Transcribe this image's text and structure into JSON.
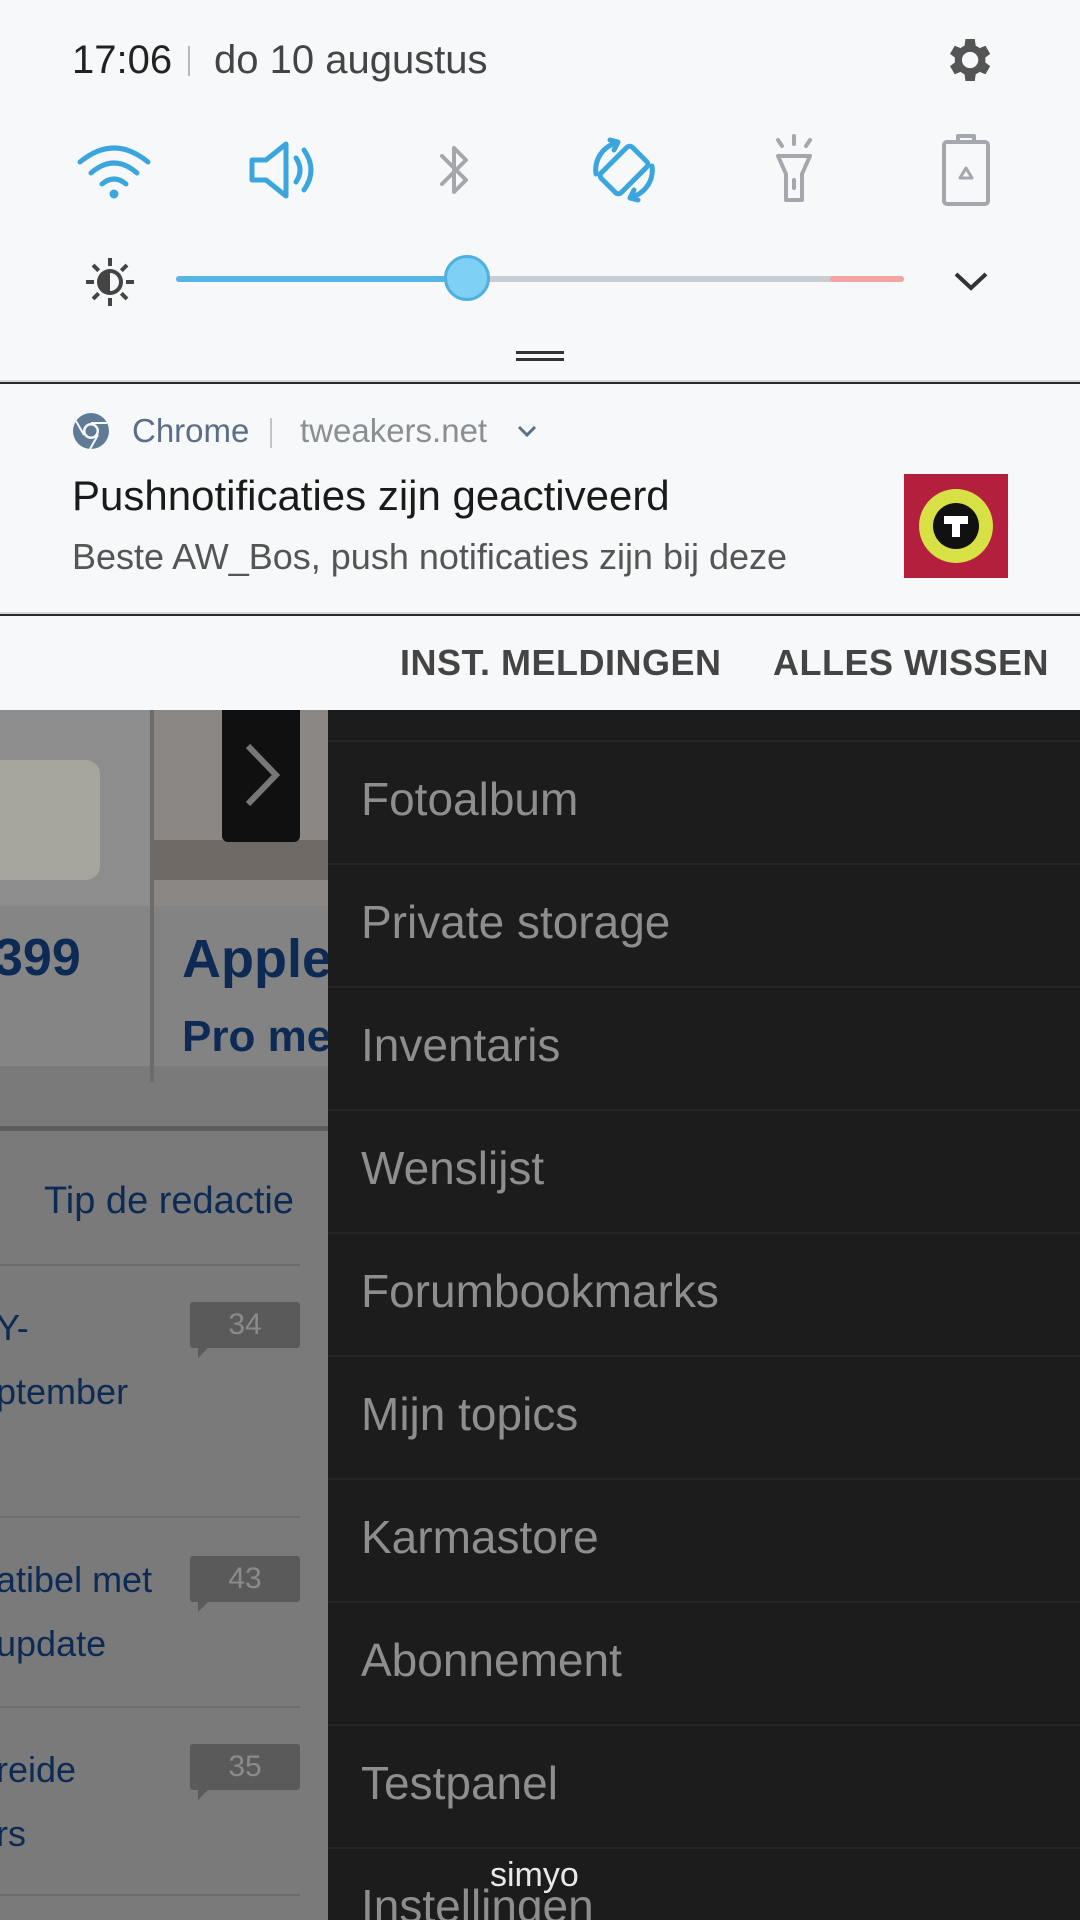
{
  "status": {
    "time": "17:06",
    "date": "do 10 augustus"
  },
  "quick_settings": {
    "tiles": [
      {
        "name": "wifi-tile",
        "icon": "wifi-icon",
        "active": true
      },
      {
        "name": "sound-tile",
        "icon": "speaker-icon",
        "active": true
      },
      {
        "name": "bluetooth-tile",
        "icon": "bluetooth-icon",
        "active": false
      },
      {
        "name": "auto-rotate-tile",
        "icon": "rotate-icon",
        "active": true
      },
      {
        "name": "flashlight-tile",
        "icon": "flashlight-icon",
        "active": false
      },
      {
        "name": "power-saving-tile",
        "icon": "battery-recycle-icon",
        "active": false
      }
    ],
    "brightness_level": 0.4,
    "accent_color": "#3aa6dd",
    "inactive_color": "#a4a8ad"
  },
  "notification": {
    "app": "Chrome",
    "site": "tweakers.net",
    "title": "Pushnotificaties zijn geactiveerd",
    "body": "Beste AW_Bos, push notificaties zijn bij deze"
  },
  "actions": {
    "settings_label": "INST. MELDINGEN",
    "clear_label": "ALLES WISSEN"
  },
  "background_page": {
    "price_fragment": "399",
    "article_title_fragment": "Apple i",
    "article_sub_fragment": "Pro met",
    "tip_label": "Tip de redactie",
    "items": [
      {
        "line1": "Y-",
        "line2": "ptember",
        "comments": "34"
      },
      {
        "line1": "atibel met",
        "line2": "update",
        "comments": "43"
      },
      {
        "line1": "reide",
        "line2": "rs",
        "comments": "35"
      }
    ]
  },
  "drawer": {
    "items": [
      "Fotoalbum",
      "Private storage",
      "Inventaris",
      "Wenslijst",
      "Forumbookmarks",
      "Mijn topics",
      "Karmastore",
      "Abonnement",
      "Testpanel",
      "Instellingen"
    ]
  },
  "carrier": "simyo"
}
